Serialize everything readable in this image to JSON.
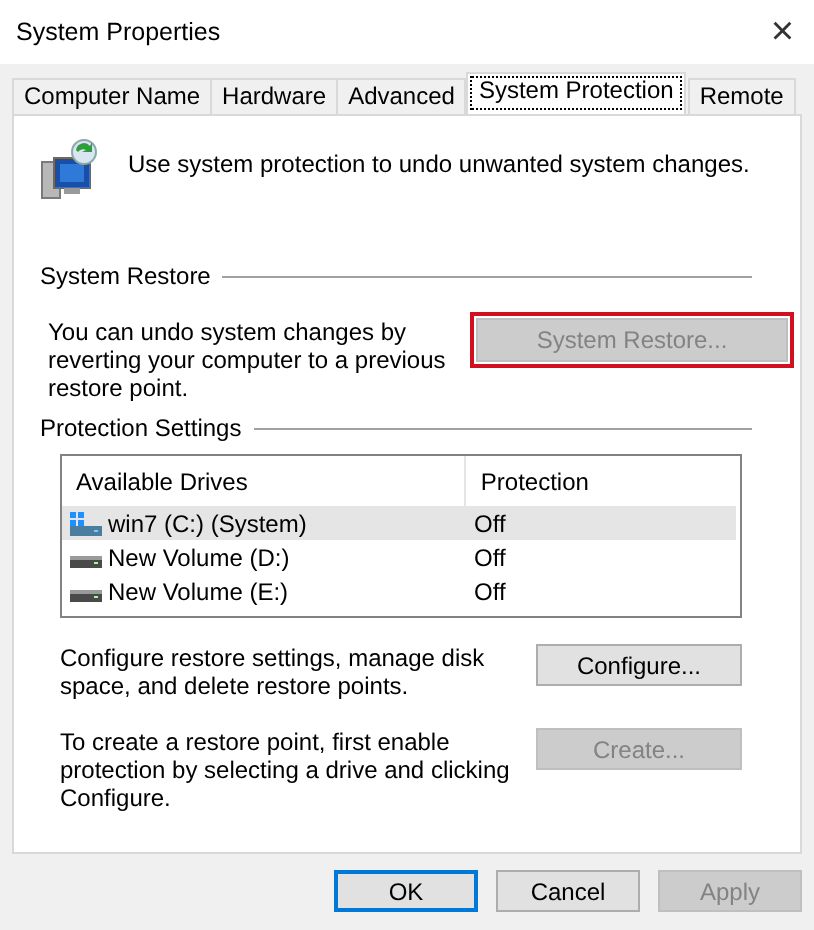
{
  "window": {
    "title": "System Properties",
    "close": "×"
  },
  "tabs": [
    {
      "label": "Computer Name",
      "selected": false
    },
    {
      "label": "Hardware",
      "selected": false
    },
    {
      "label": "Advanced",
      "selected": false
    },
    {
      "label": "System Protection",
      "selected": true
    },
    {
      "label": "Remote",
      "selected": false
    }
  ],
  "intro": "Use system protection to undo unwanted system changes.",
  "system_restore": {
    "heading": "System Restore",
    "text": "You can undo system changes by reverting your computer to a previous restore point.",
    "button": {
      "label": "System Restore...",
      "disabled": true,
      "highlighted": true
    }
  },
  "protection_settings": {
    "heading": "Protection Settings",
    "columns": [
      "Available Drives",
      "Protection"
    ],
    "rows": [
      {
        "drive": "win7 (C:) (System)",
        "protection": "Off",
        "kind": "system",
        "selected": true
      },
      {
        "drive": "New Volume (D:)",
        "protection": "Off",
        "kind": "volume",
        "selected": false
      },
      {
        "drive": "New Volume (E:)",
        "protection": "Off",
        "kind": "volume",
        "selected": false
      }
    ],
    "actions": [
      {
        "text": "Configure restore settings, manage disk space, and delete restore points.",
        "button": {
          "label": "Configure...",
          "disabled": false
        }
      },
      {
        "text": "To create a restore point, first enable protection by selecting a drive and clicking Configure.",
        "button": {
          "label": "Create...",
          "disabled": true
        }
      }
    ]
  },
  "buttons": [
    {
      "label": "OK",
      "disabled": false,
      "default": true
    },
    {
      "label": "Cancel",
      "disabled": false,
      "default": false
    },
    {
      "label": "Apply",
      "disabled": true,
      "default": false
    }
  ]
}
